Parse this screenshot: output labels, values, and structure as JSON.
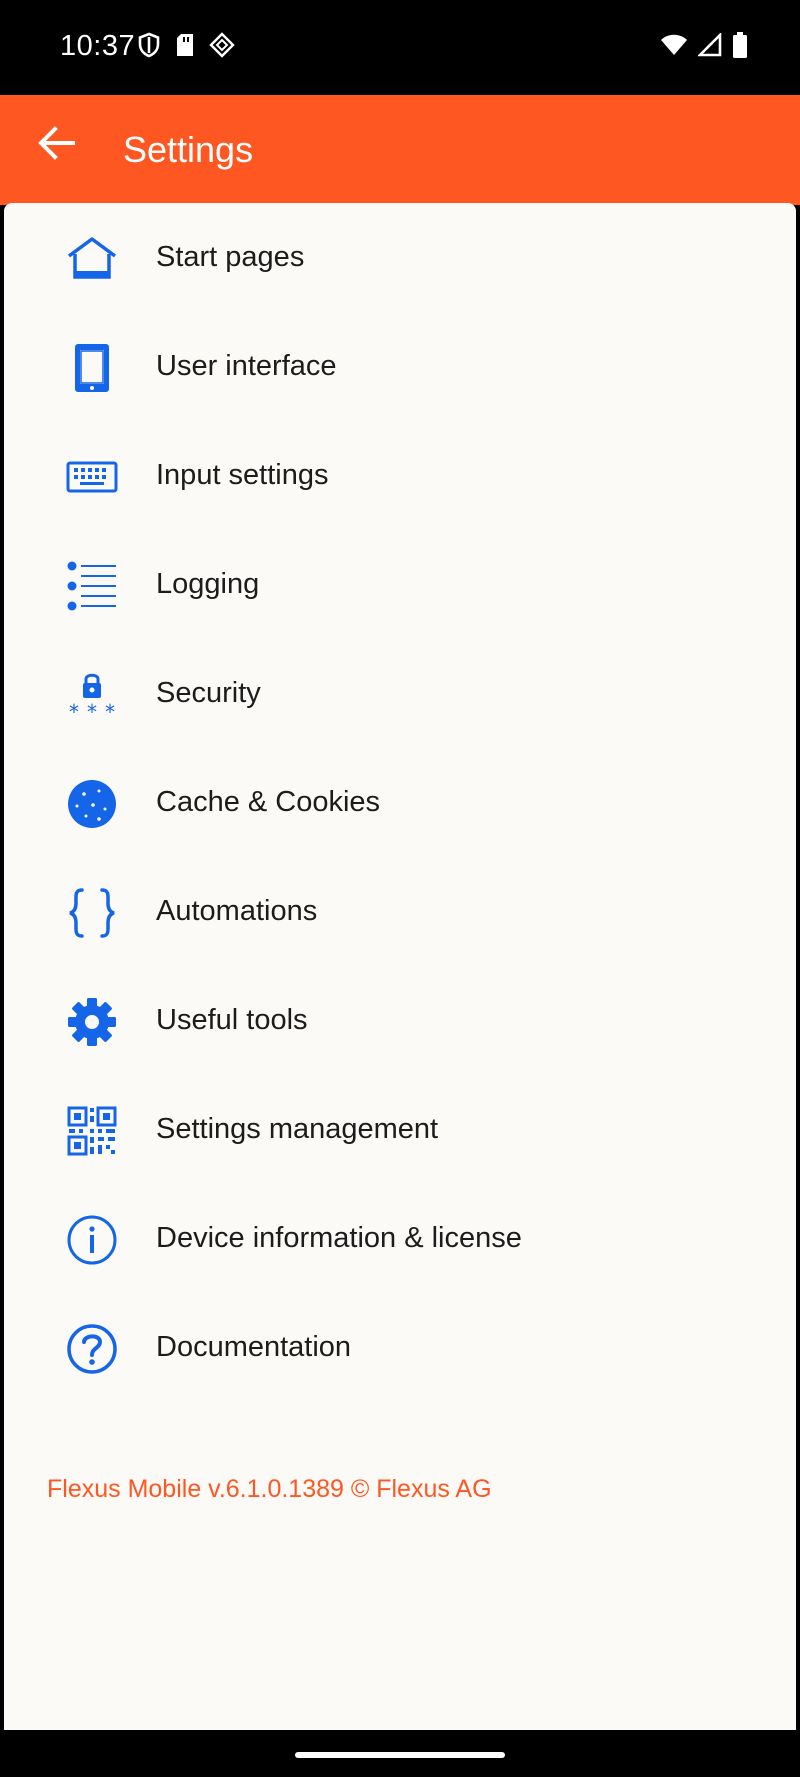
{
  "status_bar": {
    "time": "10:37",
    "left_icons": [
      "shield-icon",
      "sd-card-icon",
      "diamond-icon"
    ],
    "right_icons": [
      "wifi-icon",
      "signal-icon",
      "battery-icon"
    ]
  },
  "app_bar": {
    "title": "Settings",
    "back_icon": "arrow-back-icon",
    "color": "#ff5722"
  },
  "menu": {
    "icon_color": "#1565e8",
    "items": [
      {
        "label": "Start pages",
        "icon": "home-icon"
      },
      {
        "label": "User interface",
        "icon": "tablet-icon"
      },
      {
        "label": "Input settings",
        "icon": "keyboard-icon"
      },
      {
        "label": "Logging",
        "icon": "list-icon"
      },
      {
        "label": "Security",
        "icon": "lock-password-icon"
      },
      {
        "label": "Cache & Cookies",
        "icon": "cookie-icon"
      },
      {
        "label": "Automations",
        "icon": "braces-icon"
      },
      {
        "label": "Useful tools",
        "icon": "gear-icon"
      },
      {
        "label": "Settings management",
        "icon": "qr-code-icon"
      },
      {
        "label": "Device information & license",
        "icon": "info-icon"
      },
      {
        "label": "Documentation",
        "icon": "help-icon"
      }
    ]
  },
  "footer": {
    "version_text": "Flexus Mobile v.6.1.0.1389 © Flexus AG",
    "color": "#ff5722"
  }
}
